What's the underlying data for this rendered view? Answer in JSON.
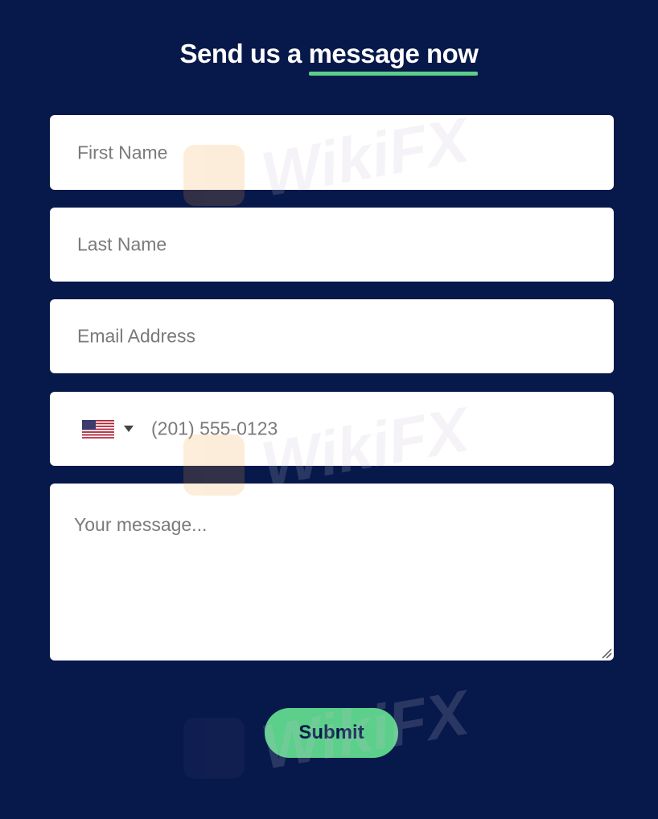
{
  "header": {
    "title_plain": "Send us a",
    "title_highlight": "message now"
  },
  "form": {
    "first_name_placeholder": "First Name",
    "last_name_placeholder": "Last Name",
    "email_placeholder": "Email Address",
    "phone_placeholder": "(201) 555-0123",
    "message_placeholder": "Your message...",
    "submit_label": "Submit"
  },
  "watermark": {
    "text": "WikiFX"
  },
  "colors": {
    "background": "#07184a",
    "accent": "#5ccf8a",
    "field_bg": "#ffffff",
    "placeholder": "#7a7a7a"
  },
  "icons": {
    "flag": "us-flag-icon",
    "dropdown": "caret-down-icon",
    "resize": "resize-handle-icon"
  }
}
